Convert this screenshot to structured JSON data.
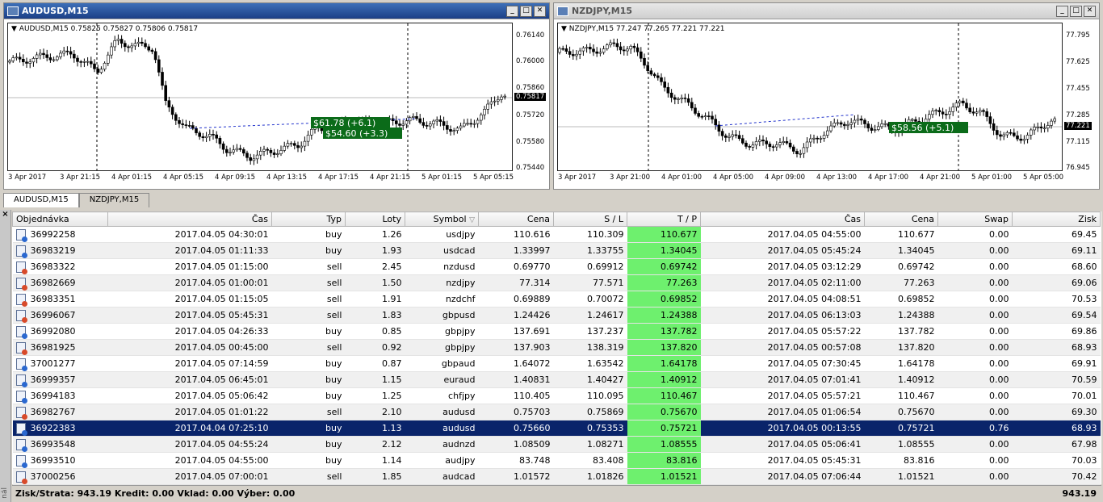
{
  "windows": [
    {
      "title": "AUDUSD,M15",
      "info": "AUDUSD,M15  0.75825 0.75827 0.75806 0.75817",
      "ylabels": [
        "0.76140",
        "0.76000",
        "0.75860",
        "0.75720",
        "0.75580",
        "0.75440"
      ],
      "ycurrent": "0.75817",
      "xlabels": [
        "3 Apr 2017",
        "3 Apr 21:15",
        "4 Apr 01:15",
        "4 Apr 05:15",
        "4 Apr 09:15",
        "4 Apr 13:15",
        "4 Apr 17:15",
        "4 Apr 21:15",
        "5 Apr 01:15",
        "5 Apr 05:15"
      ],
      "badges": [
        "$61.78 (+6.1)",
        "$54.60 (+3.3)"
      ]
    },
    {
      "title": "NZDJPY,M15",
      "info": "NZDJPY,M15  77.247 77.265 77.221 77.221",
      "ylabels": [
        "77.795",
        "77.625",
        "77.455",
        "77.285",
        "77.115",
        "76.945"
      ],
      "ycurrent": "77.221",
      "xlabels": [
        "3 Apr 2017",
        "3 Apr 21:00",
        "4 Apr 01:00",
        "4 Apr 05:00",
        "4 Apr 09:00",
        "4 Apr 13:00",
        "4 Apr 17:00",
        "4 Apr 21:00",
        "5 Apr 01:00",
        "5 Apr 05:00"
      ],
      "badges": [
        "$58.56 (+5.1)"
      ]
    }
  ],
  "window_controls": [
    "_",
    "□",
    "✕"
  ],
  "tabs": [
    "AUDUSD,M15",
    "NZDJPY,M15"
  ],
  "sidebar": {
    "close": "×",
    "label": "nál"
  },
  "table": {
    "columns": [
      "Objednávka",
      "Čas",
      "Typ",
      "Loty",
      "Symbol",
      "Cena",
      "S / L",
      "T / P",
      "Čas",
      "Cena",
      "Swap",
      "Zisk"
    ],
    "rows": [
      [
        "36992258",
        "2017.04.05 04:30:01",
        "buy",
        "1.26",
        "usdjpy",
        "110.616",
        "110.309",
        "110.677",
        "2017.04.05 04:55:00",
        "110.677",
        "0.00",
        "69.45"
      ],
      [
        "36983219",
        "2017.04.05 01:11:33",
        "buy",
        "1.93",
        "usdcad",
        "1.33997",
        "1.33755",
        "1.34045",
        "2017.04.05 05:45:24",
        "1.34045",
        "0.00",
        "69.11"
      ],
      [
        "36983322",
        "2017.04.05 01:15:00",
        "sell",
        "2.45",
        "nzdusd",
        "0.69770",
        "0.69912",
        "0.69742",
        "2017.04.05 03:12:29",
        "0.69742",
        "0.00",
        "68.60"
      ],
      [
        "36982669",
        "2017.04.05 01:00:01",
        "sell",
        "1.50",
        "nzdjpy",
        "77.314",
        "77.571",
        "77.263",
        "2017.04.05 02:11:00",
        "77.263",
        "0.00",
        "69.06"
      ],
      [
        "36983351",
        "2017.04.05 01:15:05",
        "sell",
        "1.91",
        "nzdchf",
        "0.69889",
        "0.70072",
        "0.69852",
        "2017.04.05 04:08:51",
        "0.69852",
        "0.00",
        "70.53"
      ],
      [
        "36996067",
        "2017.04.05 05:45:31",
        "sell",
        "1.83",
        "gbpusd",
        "1.24426",
        "1.24617",
        "1.24388",
        "2017.04.05 06:13:03",
        "1.24388",
        "0.00",
        "69.54"
      ],
      [
        "36992080",
        "2017.04.05 04:26:33",
        "buy",
        "0.85",
        "gbpjpy",
        "137.691",
        "137.237",
        "137.782",
        "2017.04.05 05:57:22",
        "137.782",
        "0.00",
        "69.86"
      ],
      [
        "36981925",
        "2017.04.05 00:45:00",
        "sell",
        "0.92",
        "gbpjpy",
        "137.903",
        "138.319",
        "137.820",
        "2017.04.05 00:57:08",
        "137.820",
        "0.00",
        "68.93"
      ],
      [
        "37001277",
        "2017.04.05 07:14:59",
        "buy",
        "0.87",
        "gbpaud",
        "1.64072",
        "1.63542",
        "1.64178",
        "2017.04.05 07:30:45",
        "1.64178",
        "0.00",
        "69.91"
      ],
      [
        "36999357",
        "2017.04.05 06:45:01",
        "buy",
        "1.15",
        "euraud",
        "1.40831",
        "1.40427",
        "1.40912",
        "2017.04.05 07:01:41",
        "1.40912",
        "0.00",
        "70.59"
      ],
      [
        "36994183",
        "2017.04.05 05:06:42",
        "buy",
        "1.25",
        "chfjpy",
        "110.405",
        "110.095",
        "110.467",
        "2017.04.05 05:57:21",
        "110.467",
        "0.00",
        "70.01"
      ],
      [
        "36982767",
        "2017.04.05 01:01:22",
        "sell",
        "2.10",
        "audusd",
        "0.75703",
        "0.75869",
        "0.75670",
        "2017.04.05 01:06:54",
        "0.75670",
        "0.00",
        "69.30"
      ],
      [
        "36922383",
        "2017.04.04 07:25:10",
        "buy",
        "1.13",
        "audusd",
        "0.75660",
        "0.75353",
        "0.75721",
        "2017.04.05 00:13:55",
        "0.75721",
        "0.76",
        "68.93"
      ],
      [
        "36993548",
        "2017.04.05 04:55:24",
        "buy",
        "2.12",
        "audnzd",
        "1.08509",
        "1.08271",
        "1.08555",
        "2017.04.05 05:06:41",
        "1.08555",
        "0.00",
        "67.98"
      ],
      [
        "36993510",
        "2017.04.05 04:55:00",
        "buy",
        "1.14",
        "audjpy",
        "83.748",
        "83.408",
        "83.816",
        "2017.04.05 05:45:31",
        "83.816",
        "0.00",
        "70.03"
      ],
      [
        "37000256",
        "2017.04.05 07:00:01",
        "sell",
        "1.85",
        "audcad",
        "1.01572",
        "1.01826",
        "1.01521",
        "2017.04.05 07:06:44",
        "1.01521",
        "0.00",
        "70.42"
      ]
    ],
    "selected_row": 12
  },
  "status": {
    "summary": "Zisk/Strata: 943.19  Kredit: 0.00  Vklad: 0.00  Výber: 0.00",
    "total": "943.19"
  },
  "colors": {
    "tp_green": "#6ef06e",
    "selected_row": "#0a246a",
    "badge_green": "#0b6b19",
    "candle": "#000000"
  }
}
